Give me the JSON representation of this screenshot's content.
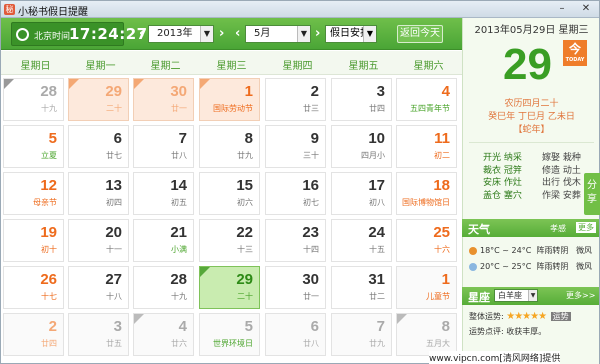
{
  "window": {
    "title": "小秘书假日提醒"
  },
  "toolbar": {
    "clock_label": "北京时间",
    "clock_time": "17:24:27",
    "prev": "‹",
    "next": "›",
    "year_value": "2013年",
    "month_prev": "‹",
    "month_next": "›",
    "month_value": "5月",
    "holiday_select": "假日安排",
    "today_button": "返回今天"
  },
  "weekdays": [
    "星期日",
    "星期一",
    "星期二",
    "星期三",
    "星期四",
    "星期五",
    "星期六"
  ],
  "days": [
    {
      "d": "28",
      "s": "十九",
      "style": "gray",
      "corner": "gray"
    },
    {
      "d": "29",
      "s": "二十",
      "style": "pink",
      "hol": true,
      "corner": "orange"
    },
    {
      "d": "30",
      "s": "廿一",
      "style": "pink",
      "hol": true,
      "corner": "orange"
    },
    {
      "d": "1",
      "s": "国际劳动节",
      "style": "red",
      "hol": true,
      "corner": "orange"
    },
    {
      "d": "2",
      "s": "廿三"
    },
    {
      "d": "3",
      "s": "廿四"
    },
    {
      "d": "4",
      "s": "五四青年节",
      "style": "red",
      "sstyle": "green"
    },
    {
      "d": "5",
      "s": "立夏",
      "style": "red",
      "sstyle": "green"
    },
    {
      "d": "6",
      "s": "廿七"
    },
    {
      "d": "7",
      "s": "廿八"
    },
    {
      "d": "8",
      "s": "廿九"
    },
    {
      "d": "9",
      "s": "三十"
    },
    {
      "d": "10",
      "s": "四月小"
    },
    {
      "d": "11",
      "s": "初二",
      "style": "red"
    },
    {
      "d": "12",
      "s": "母亲节",
      "style": "red"
    },
    {
      "d": "13",
      "s": "初四"
    },
    {
      "d": "14",
      "s": "初五"
    },
    {
      "d": "15",
      "s": "初六"
    },
    {
      "d": "16",
      "s": "初七"
    },
    {
      "d": "17",
      "s": "初八"
    },
    {
      "d": "18",
      "s": "国际博物馆日",
      "style": "red"
    },
    {
      "d": "19",
      "s": "初十",
      "style": "red"
    },
    {
      "d": "20",
      "s": "十一"
    },
    {
      "d": "21",
      "s": "小满",
      "sstyle": "green"
    },
    {
      "d": "22",
      "s": "十三"
    },
    {
      "d": "23",
      "s": "十四"
    },
    {
      "d": "24",
      "s": "十五"
    },
    {
      "d": "25",
      "s": "十六",
      "style": "red"
    },
    {
      "d": "26",
      "s": "十七",
      "style": "red"
    },
    {
      "d": "27",
      "s": "十八"
    },
    {
      "d": "28",
      "s": "十九"
    },
    {
      "d": "29",
      "s": "二十",
      "style": "green",
      "selected": true,
      "corner": "green"
    },
    {
      "d": "30",
      "s": "廿一"
    },
    {
      "d": "31",
      "s": "廿二"
    },
    {
      "d": "1",
      "s": "儿童节",
      "style": "red",
      "dim": true
    },
    {
      "d": "2",
      "s": "廿四",
      "style": "pink",
      "dim": true
    },
    {
      "d": "3",
      "s": "廿五",
      "style": "gray",
      "dim": true
    },
    {
      "d": "4",
      "s": "廿六",
      "style": "gray",
      "dim": true,
      "corner": "lgray"
    },
    {
      "d": "5",
      "s": "世界环境日",
      "style": "gray",
      "sstyle": "green",
      "dim": true
    },
    {
      "d": "6",
      "s": "廿八",
      "style": "gray",
      "dim": true
    },
    {
      "d": "7",
      "s": "廿九",
      "style": "gray",
      "dim": true
    },
    {
      "d": "8",
      "s": "五月大",
      "style": "gray",
      "dim": true,
      "corner": "lgray"
    }
  ],
  "side": {
    "date_line": "2013年05月29日 星期三",
    "big_day": "29",
    "today_tag": "今",
    "today_tag_en": "TODAY",
    "lunar1": "农历四月二十",
    "lunar2": "癸巳年  丁巳月  乙未日",
    "lunar3": "【蛇年】",
    "yi": [
      "开光 纳采",
      "裁衣 冠笄",
      "安床 作灶",
      "盖仓 塞穴"
    ],
    "ji": [
      "嫁娶 栽种",
      "修造 动土",
      "出行 伐木",
      "作梁 安葬"
    ],
    "share_tab": "分享"
  },
  "weather": {
    "title": "天气",
    "city": "孝感",
    "more": "更多",
    "rows": [
      {
        "temp": "18°C ~ 24°C",
        "desc": "阵雨转阴",
        "wind": "微风",
        "color": "#e8912e"
      },
      {
        "temp": "20°C ~ 25°C",
        "desc": "阵雨转阴",
        "wind": "微风",
        "color": "#8ab7e0"
      }
    ]
  },
  "constellation": {
    "title": "星座",
    "value": "白羊座",
    "more": "更多>>",
    "luck_label": "整体运势:",
    "stars": "★★★★★",
    "comment_label": "运势点评:",
    "comment": "收获丰厚。",
    "tag": "运势"
  },
  "watermark": "www.vipcn.com[清风网络]提供"
}
